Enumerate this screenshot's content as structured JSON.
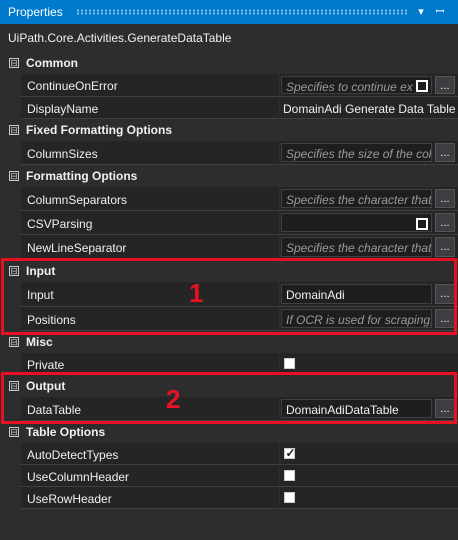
{
  "panel": {
    "title": "Properties"
  },
  "activity_name": "UiPath.Core.Activities.GenerateDataTable",
  "categories": {
    "common": "Common",
    "fixed_formatting": "Fixed Formatting Options",
    "formatting": "Formatting Options",
    "input": "Input",
    "misc": "Misc",
    "output": "Output",
    "table_options": "Table Options"
  },
  "toggle_glyph": "⊟",
  "ellipsis": "...",
  "properties": {
    "continue_on_error": {
      "label": "ContinueOnError",
      "placeholder": "Specifies to continue ex"
    },
    "display_name": {
      "label": "DisplayName",
      "value": "DomainAdi Generate Data Table"
    },
    "column_sizes": {
      "label": "ColumnSizes",
      "placeholder": "Specifies the size of the colu"
    },
    "column_separators": {
      "label": "ColumnSeparators",
      "placeholder": "Specifies the character that"
    },
    "csv_parsing": {
      "label": "CSVParsing",
      "value": ""
    },
    "newline_separator": {
      "label": "NewLineSeparator",
      "placeholder": "Specifies the character that"
    },
    "input": {
      "label": "Input",
      "value": "DomainAdi"
    },
    "positions": {
      "label": "Positions",
      "placeholder": "If OCR is used for scraping,"
    },
    "private": {
      "label": "Private",
      "checked": false
    },
    "data_table": {
      "label": "DataTable",
      "value": "DomainAdiDataTable"
    },
    "auto_detect_types": {
      "label": "AutoDetectTypes",
      "checked": true
    },
    "use_column_header": {
      "label": "UseColumnHeader",
      "checked": false
    },
    "use_row_header": {
      "label": "UseRowHeader",
      "checked": false
    }
  },
  "annotations": {
    "box1": "1",
    "box2": "2"
  },
  "colors": {
    "accent": "#007acc",
    "highlight": "#e81123",
    "background": "#252526"
  },
  "icons": [
    "dropdown-arrow-icon",
    "pin-icon",
    "collapse-icon",
    "ellipsis-button",
    "checkbox"
  ]
}
